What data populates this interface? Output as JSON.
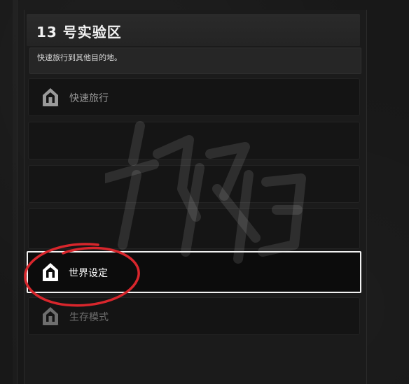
{
  "header": {
    "title": "13 号实验区",
    "description": "快速旅行到其他目的地。"
  },
  "menu": {
    "items": [
      {
        "label": "快速旅行",
        "icon": "base-tower-icon",
        "state": "normal"
      },
      {
        "label": "",
        "state": "empty"
      },
      {
        "label": "",
        "state": "empty"
      },
      {
        "label": "",
        "state": "empty"
      },
      {
        "label": "世界设定",
        "icon": "base-tower-icon",
        "state": "selected"
      },
      {
        "label": "生存模式",
        "icon": "base-tower-icon",
        "state": "dim"
      }
    ]
  },
  "colors": {
    "selected_border": "#f2f2f2",
    "annotation_circle": "#d8262c",
    "watermark": "#d9d9d9"
  }
}
